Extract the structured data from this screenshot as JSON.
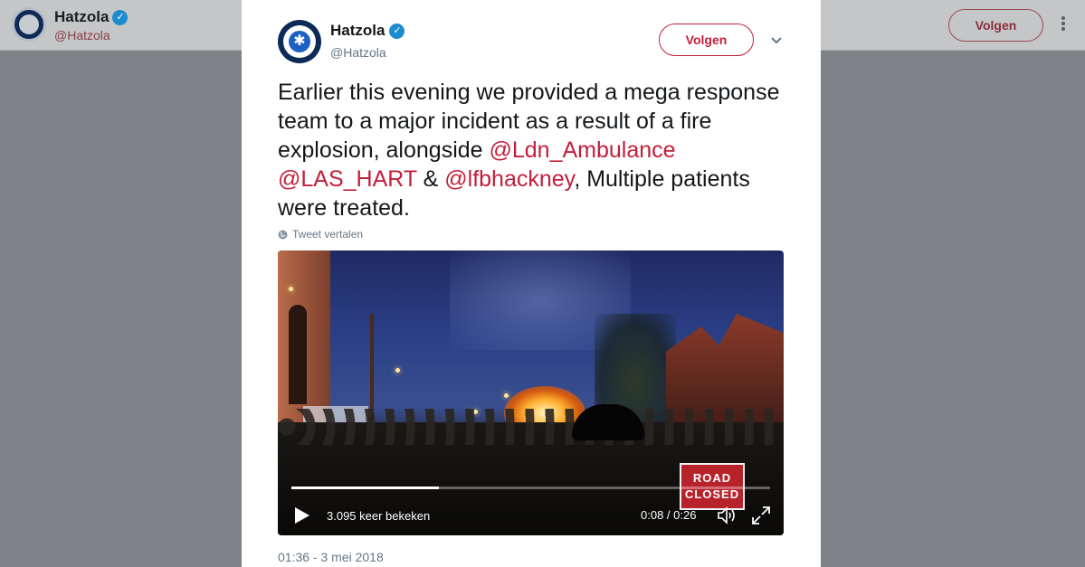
{
  "background_header": {
    "name": "Hatzola",
    "handle": "@Hatzola",
    "follow_label": "Volgen"
  },
  "tweet": {
    "author_name": "Hatzola",
    "author_handle": "@Hatzola",
    "verified": true,
    "follow_label": "Volgen",
    "text_parts": {
      "p1": "Earlier this evening we provided a mega response team to a major incident as a result of a fire explosion, alongside ",
      "m1": "@Ldn_Ambulance",
      "sp1": " ",
      "m2": "@LAS_HART",
      "p2": " & ",
      "m3": "@lfbhackney",
      "p3": ", Multiple patients were treated."
    },
    "translate_label": "Tweet vertalen",
    "timestamp": "01:36 - 3 mei 2018"
  },
  "video": {
    "views": "3.095 keer bekeken",
    "time": "0:08 / 0:26",
    "progress_fraction": 0.308,
    "sign_text_line1": "ROAD",
    "sign_text_line2": "CLOSED"
  },
  "colors": {
    "accent": "#c41e3a",
    "verified_badge": "#1d8ccf",
    "secondary_text": "#657786"
  },
  "icons": {
    "verified": "verified-badge-icon",
    "caret": "chevron-down-icon",
    "globe": "globe-icon",
    "play": "play-icon",
    "volume": "volume-icon",
    "fullscreen": "fullscreen-icon",
    "more": "more-vertical-icon"
  }
}
